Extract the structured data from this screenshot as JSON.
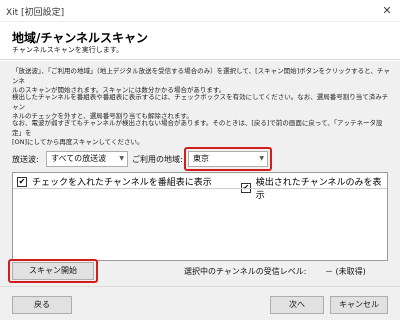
{
  "window": {
    "title": "Xit [初回設定]",
    "close_glyph": "✕"
  },
  "header": {
    "title": "地域/チャンネルスキャン",
    "subtitle": "チャンネルスキャンを実行します。"
  },
  "instructions": {
    "p1_line1": "「放送波」、「ご利用の地域」（地上デジタル放送を受信する場合のみ）を選択して、[スキャン開始]ボタンをクリックすると、チャンネ",
    "p1_line2": "ルのスキャンが開始されます。スキャンには数分かかる場合があります。",
    "p2_line1": "検出したチャンネルを番組表や番組表に表示するには、チェックボックスを有効にしてください。なお、選局番号割り当て済みチャン",
    "p2_line2": "ネルのチェックを外すと、選局番号割り当ても解除されます。",
    "p3_line1": "なお、電波が弱すぎてもチャンネルが検出されない場合があります。そのときは、[戻る]で前の画面に戻って、「アッテネータ設定」を",
    "p3_line2": "[ON]にしてから再度スキャンしてください。"
  },
  "filters": {
    "broadcast_label": "放送波:",
    "broadcast_value": "すべての放送波",
    "region_label": "ご利用の地域:",
    "region_value": "東京"
  },
  "channel_list": {
    "show_in_guide_label": "チェックを入れたチャンネルを番組表に表示",
    "show_in_guide_checked": true,
    "only_detected_label": "検出されたチャンネルのみを表示",
    "only_detected_checked": true,
    "check_glyph": "✔"
  },
  "scan": {
    "button_label": "スキャン開始",
    "signal_label": "選択中のチャンネルの受信レベル:",
    "signal_value": "－ (未取得)"
  },
  "footer": {
    "back_label": "戻る",
    "next_label": "次へ",
    "cancel_label": "キャンセル"
  },
  "colors": {
    "highlight": "#d21d1d",
    "dialog_bg": "#f0f0f0"
  }
}
